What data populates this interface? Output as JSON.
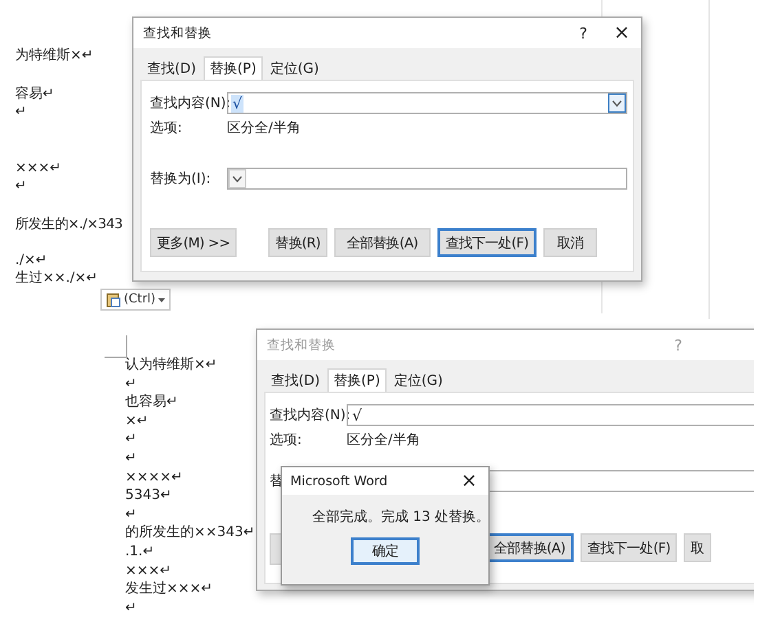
{
  "panels": [
    {
      "document": {
        "lines": [
          "为特维斯×↵",
          "容易↵",
          "↵",
          "×××↵",
          "↵",
          "所发生的×./×343",
          "./×↵",
          "生过××./×↵"
        ]
      },
      "paste_options": {
        "label": "(Ctrl)"
      },
      "dialog": {
        "title": "查找和替换",
        "active": true,
        "help": "?",
        "close": "×",
        "tabs": [
          {
            "label": "查找(D)",
            "selected": false
          },
          {
            "label": "替换(P)",
            "selected": true
          },
          {
            "label": "定位(G)",
            "selected": false
          }
        ],
        "find": {
          "label": "查找内容(N):",
          "value": "√",
          "value_selected": true
        },
        "options": {
          "label": "选项:",
          "value": "区分全/半角"
        },
        "replace": {
          "label": "替换为(I):"
        },
        "buttons": [
          {
            "label": "更多(M) >>",
            "focused": false
          },
          {
            "label": "替换(R)",
            "focused": false
          },
          {
            "label": "全部替换(A)",
            "focused": false
          },
          {
            "label": "查找下一处(F)",
            "focused": true
          },
          {
            "label": "取消",
            "focused": false
          }
        ]
      }
    },
    {
      "document": {
        "lines": [
          "认为特维斯×↵",
          "↵",
          "也容易↵",
          "×↵",
          "↵",
          "↵",
          "××××↵",
          "5343↵",
          "↵",
          "的所发生的××343↵",
          ".1.↵",
          "×××↵",
          "发生过×××↵",
          "↵"
        ]
      },
      "dialog": {
        "title": "查找和替换",
        "active": false,
        "help": "?",
        "tabs": [
          {
            "label": "查找(D)",
            "selected": false
          },
          {
            "label": "替换(P)",
            "selected": true
          },
          {
            "label": "定位(G)",
            "selected": false
          }
        ],
        "find": {
          "label": "查找内容(N):",
          "value": "√",
          "value_selected": false
        },
        "options": {
          "label": "选项:",
          "value": "区分全/半角"
        },
        "replace": {
          "label": "替"
        },
        "buttons": [
          {
            "label": "全部替换(A)",
            "focused": true
          },
          {
            "label": "查找下一处(F)",
            "focused": false
          },
          {
            "label": "取",
            "focused": false
          }
        ]
      },
      "message_box": {
        "title": "Microsoft Word",
        "close": "×",
        "message": "全部完成。完成 13 处替换。",
        "button": "确定"
      }
    }
  ]
}
